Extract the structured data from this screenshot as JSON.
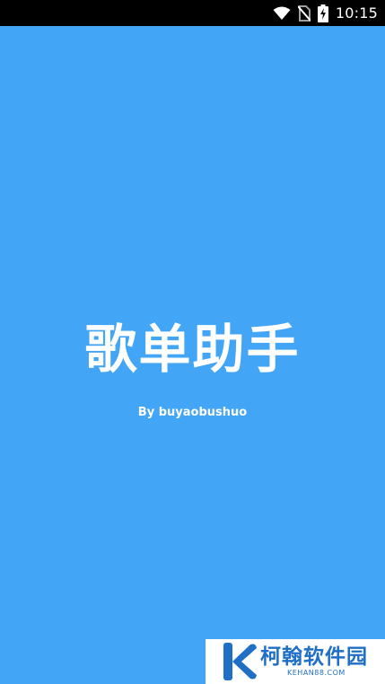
{
  "status_bar": {
    "time": "10:15",
    "icons": [
      "wifi-icon",
      "no-sim-icon",
      "battery-charging-icon"
    ]
  },
  "splash": {
    "app_title": "歌单助手",
    "author": "By buyaobushuo",
    "background_color": "#42a5f5",
    "text_color": "#ffffff"
  },
  "watermark": {
    "name": "柯翰软件园",
    "url": "KEHAN88.COM",
    "logo_icon": "k-logo-icon",
    "color": "#1f6fc6"
  }
}
